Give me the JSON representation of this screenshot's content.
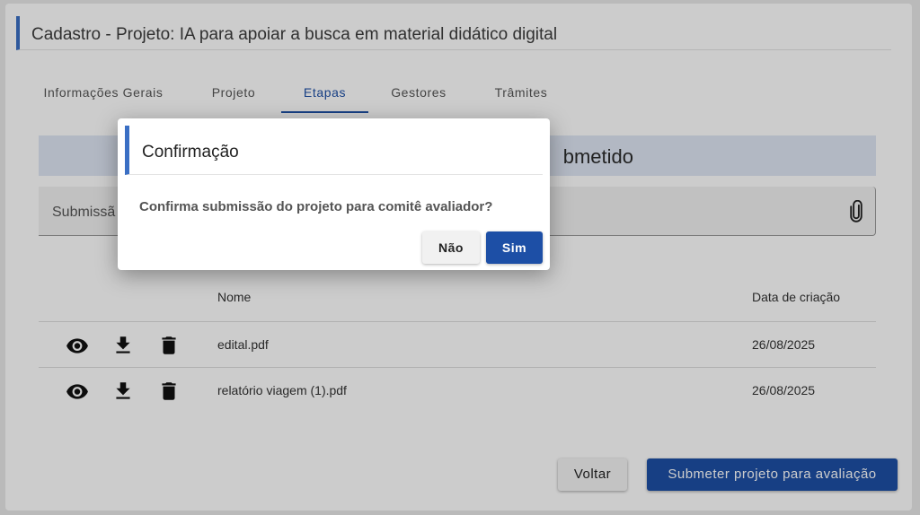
{
  "page": {
    "title": "Cadastro - Projeto: IA para apoiar a busca em material didático digital"
  },
  "tabs": [
    {
      "label": "Informações Gerais",
      "active": false
    },
    {
      "label": "Projeto",
      "active": false
    },
    {
      "label": "Etapas",
      "active": true
    },
    {
      "label": "Gestores",
      "active": false
    },
    {
      "label": "Trâmites",
      "active": false
    }
  ],
  "status_banner": {
    "text": "bmetido"
  },
  "file_field": {
    "label": "Submissã"
  },
  "table": {
    "columns": {
      "name": "Nome",
      "created": "Data de criação"
    },
    "rows": [
      {
        "name": "edital.pdf",
        "created": "26/08/2025"
      },
      {
        "name": "relatório viagem (1).pdf",
        "created": "26/08/2025"
      }
    ]
  },
  "actions": {
    "back_label": "Voltar",
    "submit_label": "Submeter projeto para avaliação"
  },
  "modal": {
    "title": "Confirmação",
    "message": "Confirma submissão do projeto para comitê avaliador?",
    "no_label": "Não",
    "yes_label": "Sim"
  },
  "icons": {
    "view": "eye-icon",
    "download": "download-icon",
    "delete": "trash-icon",
    "attach": "paperclip-icon"
  },
  "colors": {
    "primary": "#1d4fa6",
    "accent_bar": "#3a6fc4",
    "banner": "#dfe7f4"
  }
}
